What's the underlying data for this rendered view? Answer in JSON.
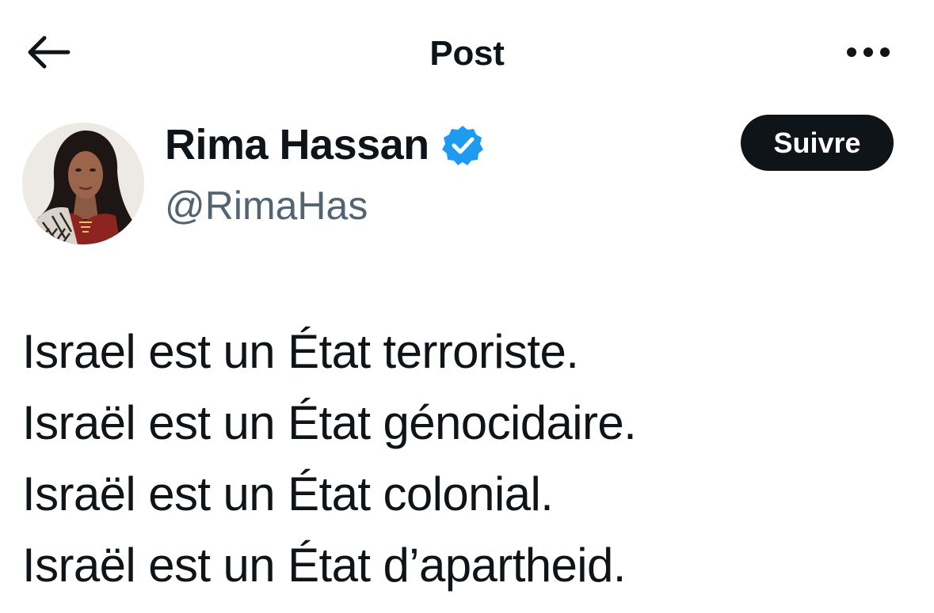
{
  "header": {
    "title": "Post",
    "back_icon": "arrow-left-icon",
    "more_icon": "more-horizontal-icon"
  },
  "author": {
    "display_name": "Rima Hassan",
    "handle": "@RimaHas",
    "verified": true,
    "verified_icon": "verified-badge-icon",
    "verified_color": "#1d9bf0"
  },
  "follow_button": {
    "label": "Suivre",
    "background": "#0f1419",
    "text_color": "#ffffff"
  },
  "post": {
    "lines": [
      "Israel est un État terroriste.",
      "Israël est un État génocidaire.",
      "Israël est un État colonial.",
      "Israël est un État d’apartheid."
    ]
  }
}
